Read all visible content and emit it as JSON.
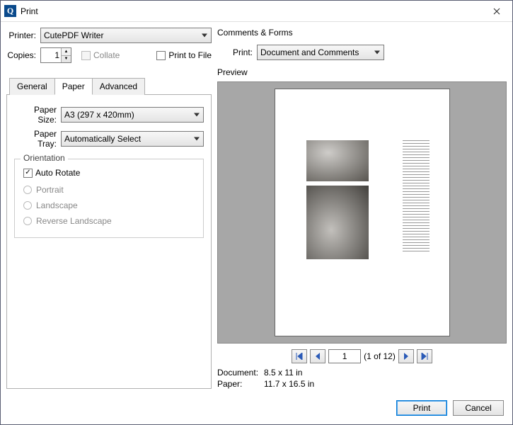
{
  "window": {
    "title": "Print"
  },
  "printer": {
    "label": "Printer:",
    "value": "CutePDF Writer"
  },
  "copies": {
    "label": "Copies:",
    "value": "1",
    "collate": "Collate",
    "print_to_file": "Print to File"
  },
  "tabs": {
    "general": "General",
    "paper": "Paper",
    "advanced": "Advanced"
  },
  "paper_tab": {
    "size_label": "Paper Size:",
    "size_value": "A3 (297 x 420mm)",
    "tray_label": "Paper Tray:",
    "tray_value": "Automatically Select",
    "orientation": {
      "legend": "Orientation",
      "auto_rotate": "Auto Rotate",
      "portrait": "Portrait",
      "landscape": "Landscape",
      "reverse": "Reverse Landscape"
    }
  },
  "comments": {
    "legend": "Comments & Forms",
    "print_label": "Print:",
    "value": "Document and Comments"
  },
  "preview": {
    "legend": "Preview",
    "page_value": "1",
    "page_count": "(1 of 12)",
    "doc_label": "Document:",
    "doc_value": "8.5 x 11 in",
    "paper_label": "Paper:",
    "paper_value": "11.7 x 16.5 in"
  },
  "buttons": {
    "print": "Print",
    "cancel": "Cancel"
  }
}
